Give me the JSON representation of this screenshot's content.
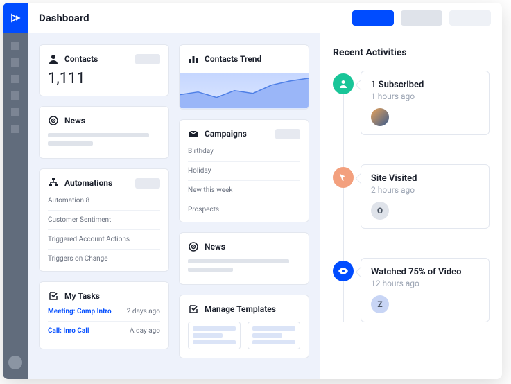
{
  "header": {
    "title": "Dashboard"
  },
  "contacts": {
    "label": "Contacts",
    "count": "1,111"
  },
  "news": {
    "label": "News"
  },
  "automations": {
    "label": "Automations",
    "items": [
      "Automation 8",
      "Customer Sentiment",
      "Triggered Account Actions",
      "Triggers on Change"
    ]
  },
  "tasks": {
    "label": "My Tasks",
    "rows": [
      {
        "name": "Meeting: Camp Intro",
        "time": "2 days ago"
      },
      {
        "name": "Call: Inro Call",
        "time": "A day ago"
      }
    ]
  },
  "trend": {
    "label": "Contacts Trend"
  },
  "campaigns": {
    "label": "Campaigns",
    "items": [
      "Birthday",
      "Holiday",
      "New this week",
      "Prospects"
    ]
  },
  "news2": {
    "label": "News"
  },
  "templates": {
    "label": "Manage Templates"
  },
  "activities": {
    "title": "Recent Activities",
    "items": [
      {
        "title": "1 Subscribed",
        "time": "1 hours ago",
        "avatar_letter": ""
      },
      {
        "title": "Site Visited",
        "time": "2 hours ago",
        "avatar_letter": "O"
      },
      {
        "title": "Watched 75% of Video",
        "time": "12 hours ago",
        "avatar_letter": "Z"
      }
    ]
  },
  "chart_data": {
    "type": "area",
    "title": "Contacts Trend",
    "x": [
      0,
      1,
      2,
      3,
      4,
      5,
      6,
      7
    ],
    "values": [
      30,
      34,
      28,
      36,
      32,
      42,
      48,
      52
    ],
    "ylim": [
      0,
      60
    ]
  }
}
